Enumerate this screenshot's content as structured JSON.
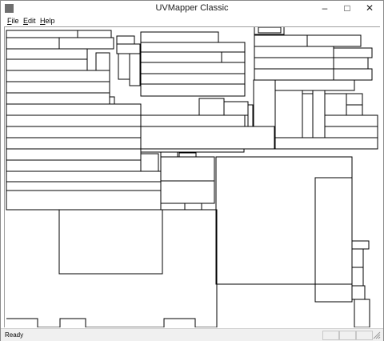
{
  "window": {
    "title": "UVMapper Classic"
  },
  "controls": {
    "minimize": "–",
    "maximize": "□",
    "close": "✕"
  },
  "menu": [
    {
      "hotkey": "F",
      "rest": "ile"
    },
    {
      "hotkey": "E",
      "rest": "dit"
    },
    {
      "hotkey": "H",
      "rest": "elp"
    }
  ],
  "status": {
    "text": "Ready"
  },
  "icons": {
    "app": "app-icon",
    "resize": "resize-grip-icon"
  },
  "colors": {
    "stroke": "#000000",
    "canvas": "#ffffff",
    "statusbar": "#f0f0f0"
  }
}
